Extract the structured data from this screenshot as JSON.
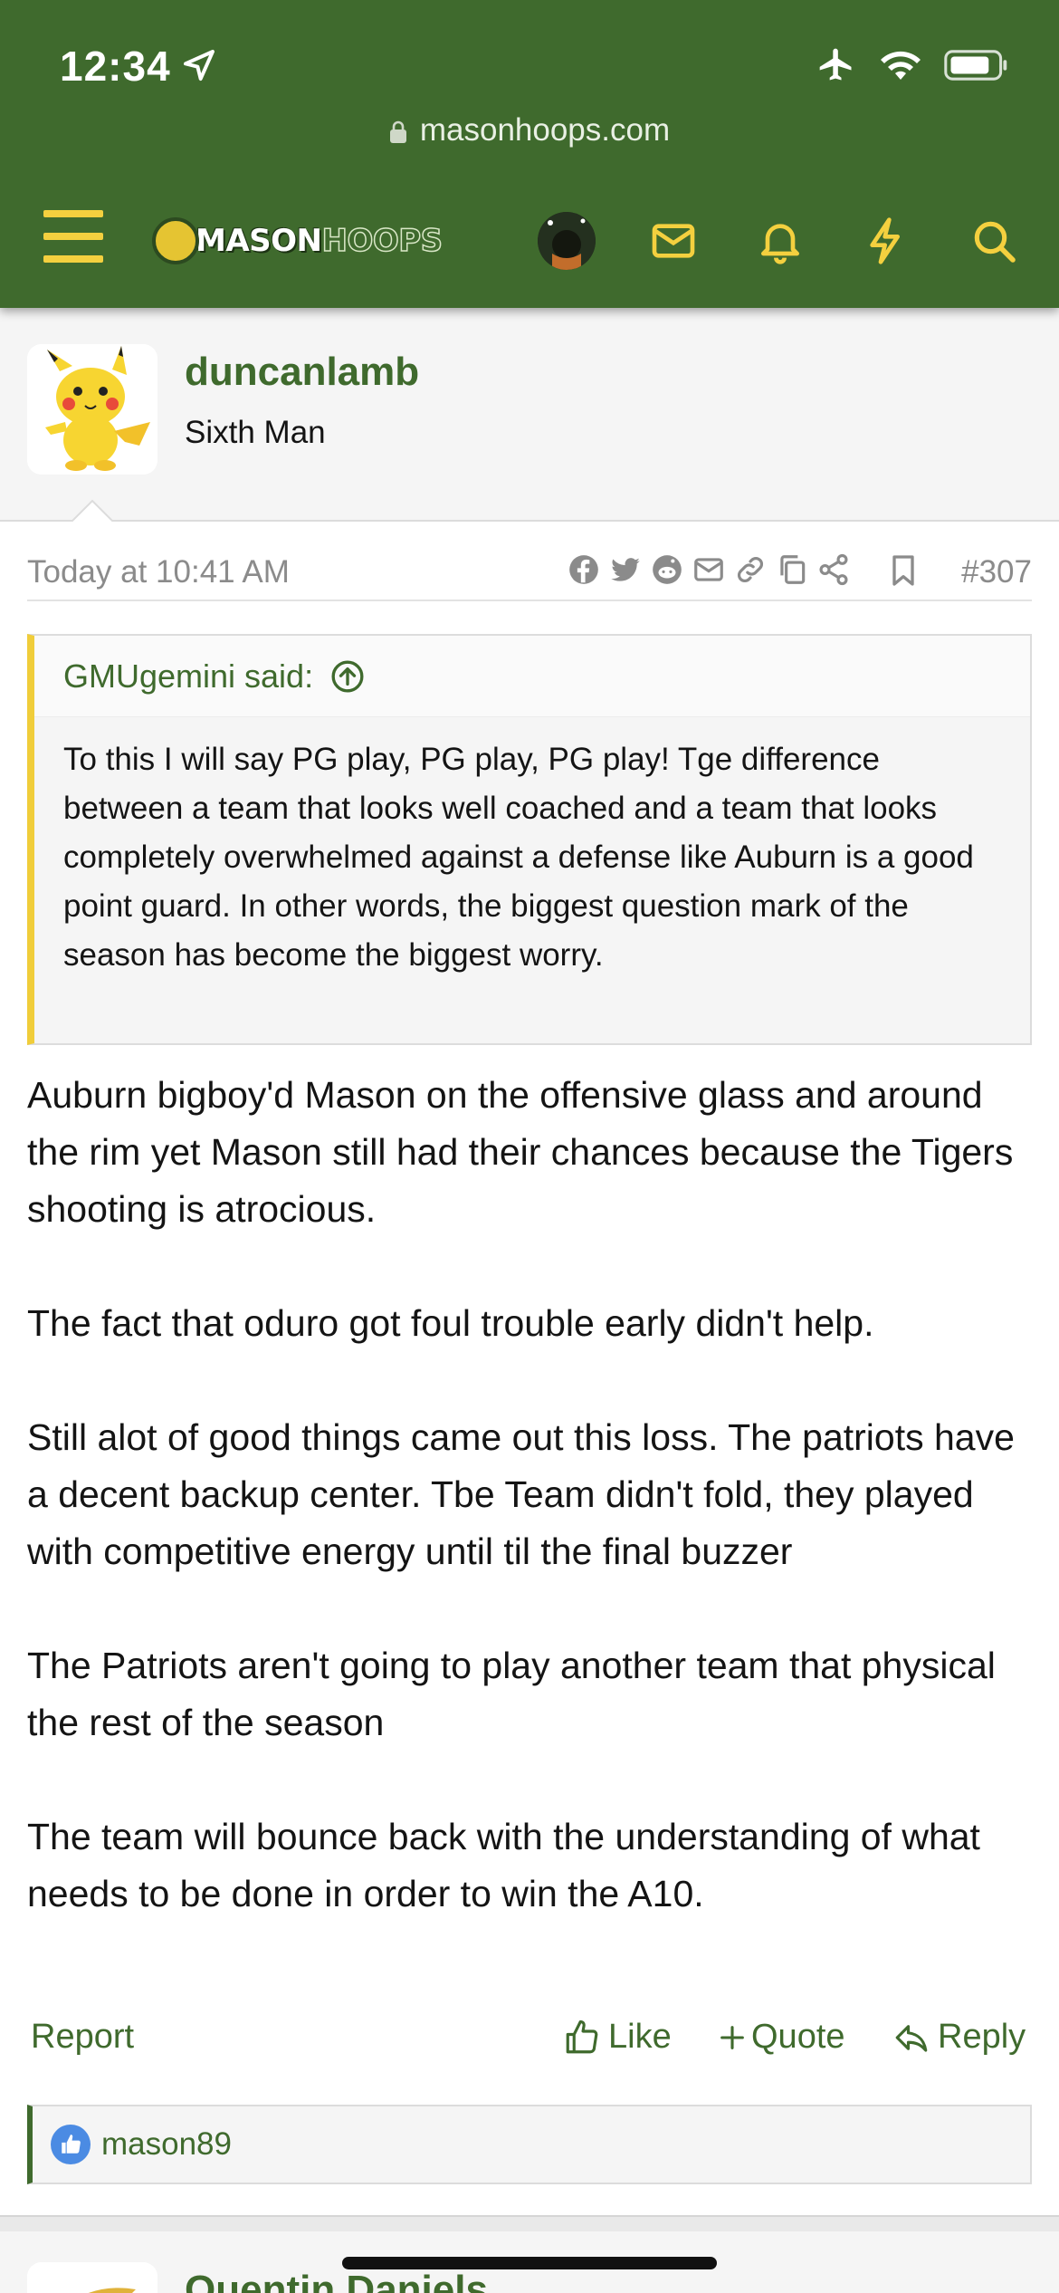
{
  "status_bar": {
    "time": "12:34"
  },
  "browser": {
    "url": "masonhoops.com"
  },
  "site": {
    "logo_part1": "MASON",
    "logo_part2": "HOOPS"
  },
  "post": {
    "author": "duncanlamb",
    "author_title": "Sixth Man",
    "date": "Today at 10:41 AM",
    "post_number": "#307",
    "quote": {
      "author": "GMUgemini said:",
      "text": "To this I will say PG play, PG play, PG play! Tge difference between a team that looks well coached and a team that looks completely overwhelmed against a defense like Auburn is a good point guard. In other words, the biggest question mark of the season has become the biggest worry."
    },
    "paragraphs": [
      "Auburn bigboy'd Mason on the offensive glass and around the rim yet Mason still had their chances because the Tigers shooting is atrocious.",
      "The fact that oduro got foul trouble early didn't help.",
      "Still alot of good things came out this loss. The patriots have a decent backup center. Tbe Team didn't fold, they played with competitive energy until til the final buzzer",
      "The Patriots aren't going to play another team that physical the rest of the season",
      "The team will bounce back with the understanding of what needs to be done in order to win the A10."
    ],
    "actions": {
      "report": "Report",
      "like": "Like",
      "quote": "Quote",
      "reply": "Reply"
    },
    "reactions": {
      "users": "mason89"
    }
  },
  "next_post": {
    "author": "Quentin Daniels"
  },
  "colors": {
    "brand_green": "#3f6a2d",
    "accent_yellow": "#f4d03f",
    "like_blue": "#4b8be3"
  }
}
